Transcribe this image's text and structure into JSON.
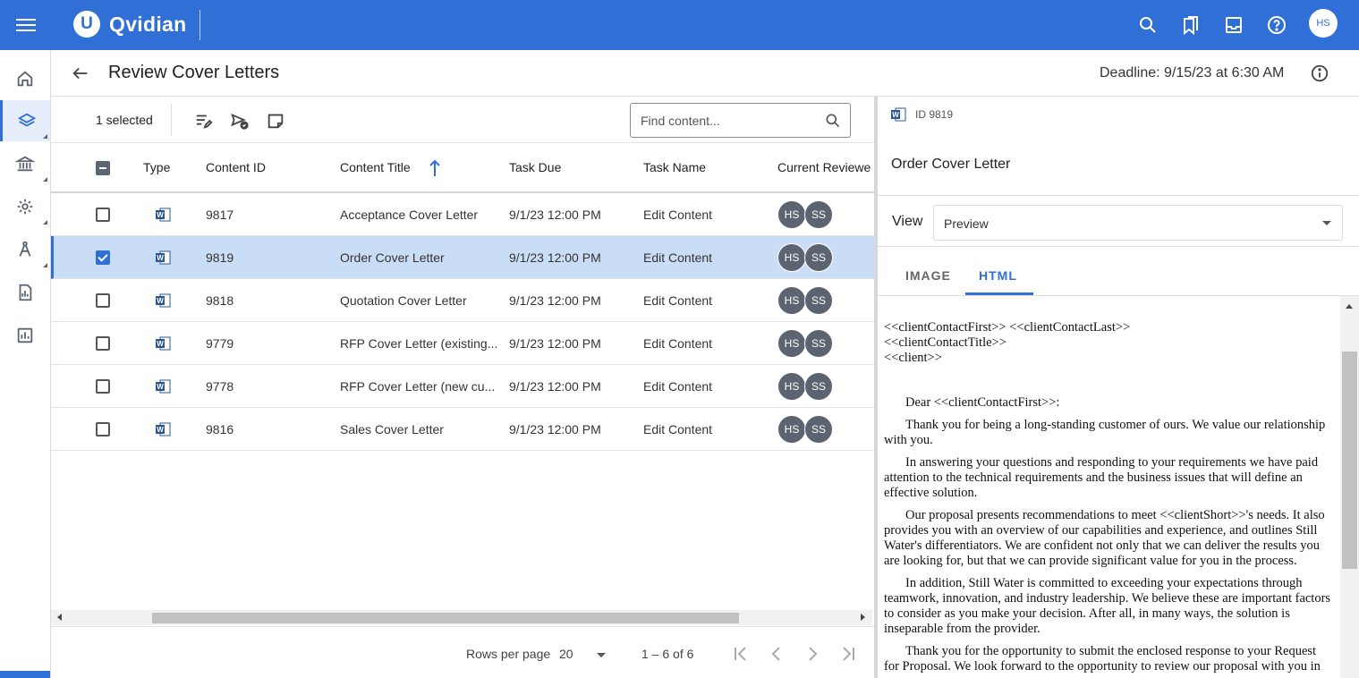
{
  "app": {
    "brand": "Qvidian",
    "logo_letter": "U",
    "user_initials": "HS"
  },
  "topbar": {
    "icons": [
      "menu-icon",
      "search-icon",
      "bookmarks-icon",
      "inbox-icon",
      "help-icon"
    ]
  },
  "sidenav": {
    "items": [
      "home-icon",
      "layers-icon",
      "bank-icon",
      "gear-icon",
      "compass-icon",
      "report-icon",
      "chart-icon"
    ],
    "active": "layers-icon"
  },
  "header": {
    "title": "Review Cover Letters",
    "deadline": "Deadline: 9/15/23 at 6:30 AM"
  },
  "toolbar": {
    "selected": "1 selected",
    "search_placeholder": "Find content..."
  },
  "table": {
    "columns": [
      "Type",
      "Content ID",
      "Content Title",
      "Task Due",
      "Task Name",
      "Current Reviewe"
    ],
    "rows": [
      {
        "id": "9817",
        "title": "Acceptance Cover Letter",
        "due": "9/1/23 12:00 PM",
        "task": "Edit Content",
        "reviewers": [
          "HS",
          "SS"
        ],
        "selected": false
      },
      {
        "id": "9819",
        "title": "Order Cover Letter",
        "due": "9/1/23 12:00 PM",
        "task": "Edit Content",
        "reviewers": [
          "HS",
          "SS"
        ],
        "selected": true
      },
      {
        "id": "9818",
        "title": "Quotation Cover Letter",
        "due": "9/1/23 12:00 PM",
        "task": "Edit Content",
        "reviewers": [
          "HS",
          "SS"
        ],
        "selected": false
      },
      {
        "id": "9779",
        "title": "RFP Cover Letter (existing...",
        "due": "9/1/23 12:00 PM",
        "task": "Edit Content",
        "reviewers": [
          "HS",
          "SS"
        ],
        "selected": false
      },
      {
        "id": "9778",
        "title": "RFP Cover Letter (new cu...",
        "due": "9/1/23 12:00 PM",
        "task": "Edit Content",
        "reviewers": [
          "HS",
          "SS"
        ],
        "selected": false
      },
      {
        "id": "9816",
        "title": "Sales Cover Letter",
        "due": "9/1/23 12:00 PM",
        "task": "Edit Content",
        "reviewers": [
          "HS",
          "SS"
        ],
        "selected": false
      }
    ]
  },
  "pager": {
    "rows_label": "Rows per page",
    "rows_value": "20",
    "range": "1 – 6 of 6"
  },
  "detail": {
    "id_label": "ID 9819",
    "title": "Order Cover Letter",
    "view_label": "View",
    "view_value": "Preview",
    "tabs": [
      "IMAGE",
      "HTML"
    ],
    "active_tab": "HTML",
    "preview": {
      "address": [
        "<<clientContactFirst>> <<clientContactLast>>",
        "<<clientContactTitle>>",
        "<<client>>"
      ],
      "salutation": "Dear <<clientContactFirst>>:",
      "paragraphs": [
        "Thank you for being a long-standing customer of ours. We value our relationship with you.",
        "In answering your questions and responding to your requirements we have paid attention to the technical requirements and the business issues that will define an effective solution.",
        "Our proposal presents recommendations to meet <<clientShort>>'s needs. It also provides you with an overview of our capabilities and experience, and outlines Still Water's differentiators. We are confident not only that we can deliver the results you are looking for, but that we can provide significant value for you in the process.",
        "In addition, Still Water is committed to exceeding your expectations through teamwork, innovation, and industry leadership. We believe these are important factors to consider as you make your decision. After all, in many ways, the solution is inseparable from the provider.",
        "Thank you for the opportunity to submit the enclosed response to your Request for Proposal. We look forward to the opportunity to review our proposal with you in"
      ]
    }
  },
  "colors": {
    "brand_blue": "#2f6fd6",
    "selected_row": "#c9ddf6",
    "avatar_gray": "#5b6470"
  }
}
